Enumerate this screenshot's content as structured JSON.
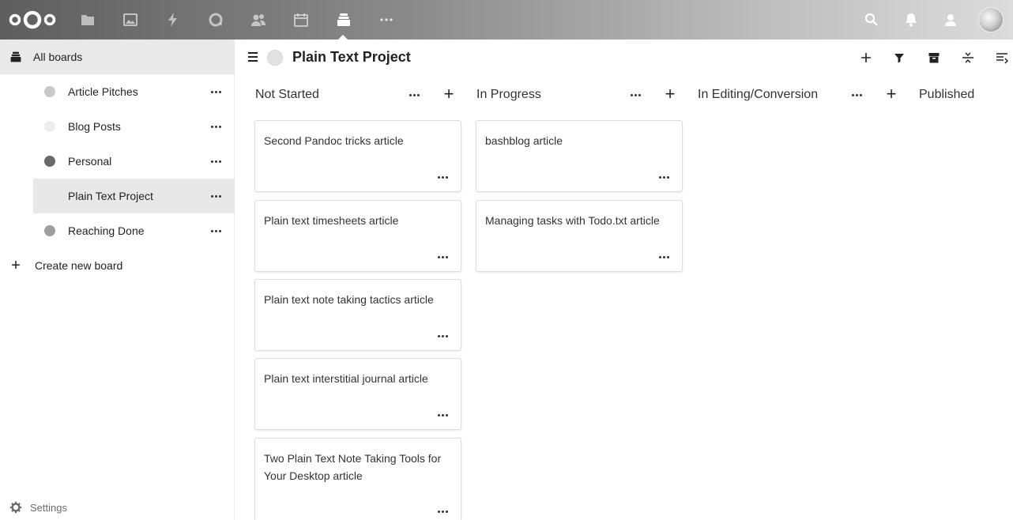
{
  "header": {
    "apps": [
      {
        "name": "files-icon"
      },
      {
        "name": "photos-icon"
      },
      {
        "name": "activity-icon"
      },
      {
        "name": "talk-icon"
      },
      {
        "name": "contacts-icon"
      },
      {
        "name": "calendar-icon"
      },
      {
        "name": "deck-icon"
      },
      {
        "name": "more-apps-icon"
      }
    ]
  },
  "sidebar": {
    "all_boards": "All boards",
    "boards": [
      {
        "label": "Article Pitches",
        "color": "#c9c9c9"
      },
      {
        "label": "Blog Posts",
        "color": "#ededed"
      },
      {
        "label": "Personal",
        "color": "#6b6b6b"
      },
      {
        "label": "Plain Text Project",
        "color": "#e6e6e6"
      },
      {
        "label": "Reaching Done",
        "color": "#9e9e9e"
      }
    ],
    "create": "Create new board",
    "settings": "Settings"
  },
  "board": {
    "title": "Plain Text Project"
  },
  "stacks": [
    {
      "title": "Not Started",
      "cards": [
        "Second Pandoc tricks article",
        "Plain text timesheets article",
        "Plain text note taking tactics article",
        "Plain text interstitial journal article",
        "Two Plain Text Note Taking Tools for Your Desktop article"
      ]
    },
    {
      "title": "In Progress",
      "cards": [
        "bashblog article",
        "Managing tasks with Todo.txt article"
      ]
    },
    {
      "title": "In Editing/Conversion",
      "cards": []
    },
    {
      "title": "Published",
      "cards": []
    }
  ]
}
